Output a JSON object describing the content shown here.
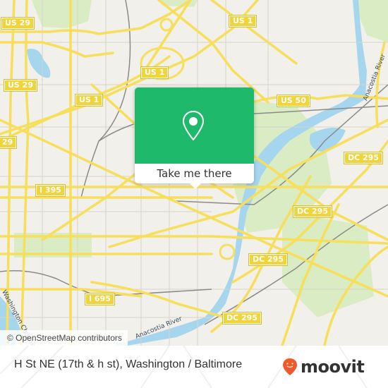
{
  "map": {
    "colors": {
      "background": "#f2f0ea",
      "road": "#f7de5b",
      "water": "#a6d6ee",
      "park": "#d9ecc4",
      "rail": "#8a8a8a",
      "popup": "#1fb96b",
      "logo_pin": "#f05a28"
    },
    "shields": [
      {
        "label": "US 29"
      },
      {
        "label": "US 29"
      },
      {
        "label": "29"
      },
      {
        "label": "US 1"
      },
      {
        "label": "US 1"
      },
      {
        "label": "US 1"
      },
      {
        "label": "US 50"
      },
      {
        "label": "DC 295"
      },
      {
        "label": "DC 295"
      },
      {
        "label": "DC 295"
      },
      {
        "label": "DC 295"
      },
      {
        "label": "I 395"
      },
      {
        "label": "I 695"
      }
    ],
    "river_labels": [
      {
        "label": "Anacostia River"
      },
      {
        "label": "Anacostia River"
      },
      {
        "label": "Washington Channel"
      }
    ],
    "attribution": "© OpenStreetMap contributors"
  },
  "popup": {
    "icon": "location-pin-icon",
    "button_label": "Take me there"
  },
  "footer": {
    "place_name": "H St NE (17th & h st), Washington / Baltimore",
    "logo_text": "moovit",
    "logo_icon": "moovit-pin-icon"
  }
}
